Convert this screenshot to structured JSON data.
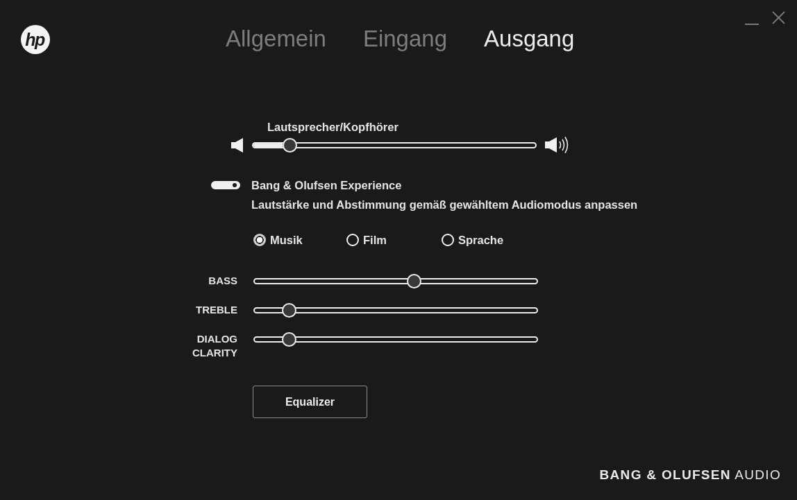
{
  "header": {
    "logo": "hp",
    "tabs": [
      {
        "label": "Allgemein",
        "selected": false
      },
      {
        "label": "Eingang",
        "selected": false
      },
      {
        "label": "Ausgang",
        "selected": true
      }
    ]
  },
  "volume": {
    "label": "Lautsprecher/Kopfhörer",
    "level": 0.11
  },
  "experience": {
    "title": "Bang & Olufsen Experience",
    "description": "Lautstärke und Abstimmung gemäß gewähltem Audiomodus anpassen",
    "on": true
  },
  "modes": [
    {
      "label": "Musik",
      "selected": true
    },
    {
      "label": "Film",
      "selected": false
    },
    {
      "label": "Sprache",
      "selected": false
    }
  ],
  "eq_sliders": [
    {
      "label": "BASS",
      "level": 0.57
    },
    {
      "label": "TREBLE",
      "level": 0.1
    },
    {
      "label": "DIALOG CLARITY",
      "level": 0.1
    }
  ],
  "equalizer_button": "Equalizer",
  "footer": "**BANG & OLUFSEN** AUDIO"
}
